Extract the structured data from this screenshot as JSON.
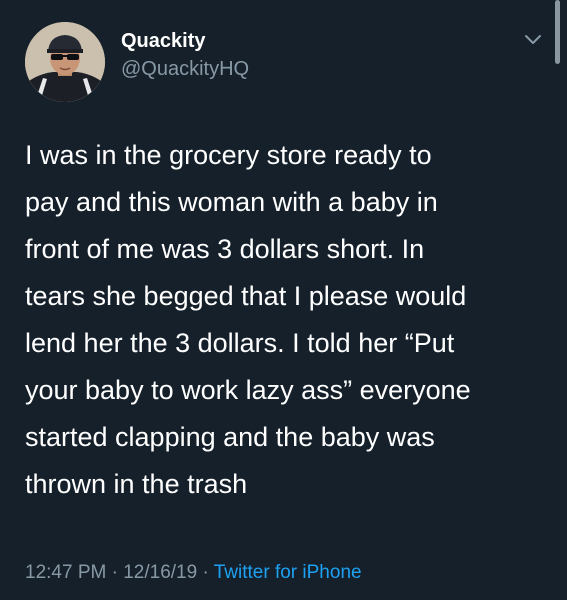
{
  "user": {
    "display_name": "Quackity",
    "handle": "@QuackityHQ",
    "avatar_icon": "profile-photo"
  },
  "tweet": {
    "lines": [
      "I was in the grocery store ready to",
      "pay and this woman with a baby in",
      "front of me was 3 dollars short. In",
      "tears she begged that I please would",
      "lend her the 3 dollars. I told her “Put",
      "your baby to work lazy ass” everyone",
      "started clapping and the baby was",
      "thrown in the trash"
    ]
  },
  "meta": {
    "time": "12:47 PM",
    "separator": "·",
    "date": "12/16/19",
    "source": "Twitter for iPhone"
  },
  "icons": {
    "menu": "chevron-down-icon"
  },
  "colors": {
    "background": "#15202b",
    "primary_text": "#ffffff",
    "secondary_text": "#8899a6",
    "link": "#1da1f2"
  }
}
